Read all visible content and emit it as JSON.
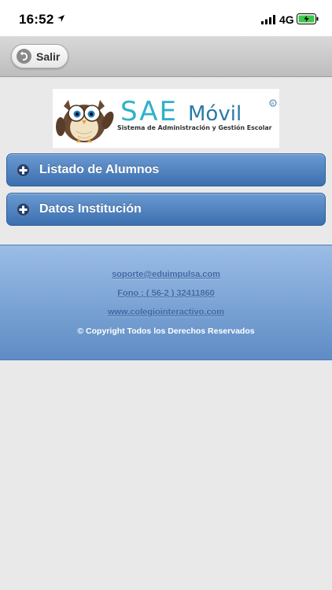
{
  "status_bar": {
    "time": "16:52",
    "network": "4G"
  },
  "header": {
    "back_label": "Salir"
  },
  "logo": {
    "brand_text": "SAE Móvil",
    "tagline": "Sistema de Administración y Gestión Escolar"
  },
  "menu": {
    "items": [
      {
        "label": "Listado de Alumnos"
      },
      {
        "label": "Datos Institución"
      }
    ]
  },
  "footer": {
    "email": "soporte@eduimpulsa.com",
    "phone": "Fono : ( 56-2 ) 32411860",
    "website": "www.colegiointeractivo.com",
    "copyright": "© Copyright Todos los Derechos Reservados"
  },
  "colors": {
    "menu_button": "#4a7fbf",
    "footer": "#7aa3d6",
    "link": "#4068a3"
  }
}
